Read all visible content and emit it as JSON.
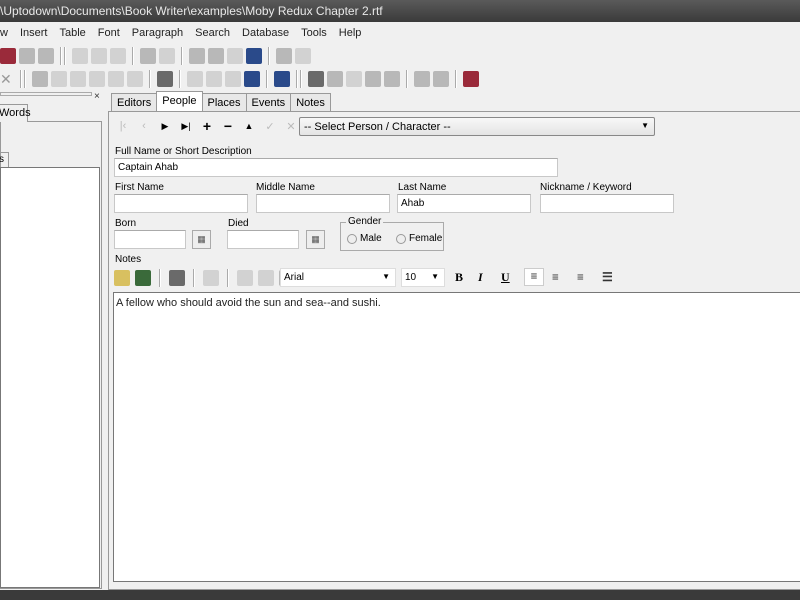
{
  "window": {
    "title": "\\Uptodown\\Documents\\Book Writer\\examples\\Moby Redux Chapter 2.rtf"
  },
  "menu": [
    "w",
    "Insert",
    "Table",
    "Font",
    "Paragraph",
    "Search",
    "Database",
    "Tools",
    "Help"
  ],
  "left_pane": {
    "tab_label": "Words",
    "tab2_label": "s",
    "close": "×"
  },
  "tabs": [
    "Editors",
    "People",
    "Places",
    "Events",
    "Notes"
  ],
  "active_tab": "People",
  "person_select": {
    "value": "-- Select Person / Character --"
  },
  "nav": {
    "first": "|‹",
    "prev": "‹",
    "next": "▶",
    "last": "▶|",
    "add": "+",
    "remove": "−",
    "up": "▲",
    "edit": "✓",
    "cancel": "✕"
  },
  "form": {
    "full_name": {
      "label": "Full Name or Short Description",
      "value": "Captain Ahab"
    },
    "first_name": {
      "label": "First Name",
      "value": ""
    },
    "middle_name": {
      "label": "Middle Name",
      "value": ""
    },
    "last_name": {
      "label": "Last Name",
      "value": "Ahab"
    },
    "nickname": {
      "label": "Nickname / Keyword",
      "value": ""
    },
    "born": {
      "label": "Born",
      "value": ""
    },
    "died": {
      "label": "Died",
      "value": ""
    },
    "gender": {
      "label": "Gender",
      "options": [
        "Male",
        "Female"
      ]
    },
    "notes": {
      "label": "Notes",
      "font": "Arial",
      "size": "10",
      "bold": "B",
      "italic": "I",
      "underline": "U",
      "text": "A fellow who should avoid the sun and sea--and sushi."
    }
  }
}
